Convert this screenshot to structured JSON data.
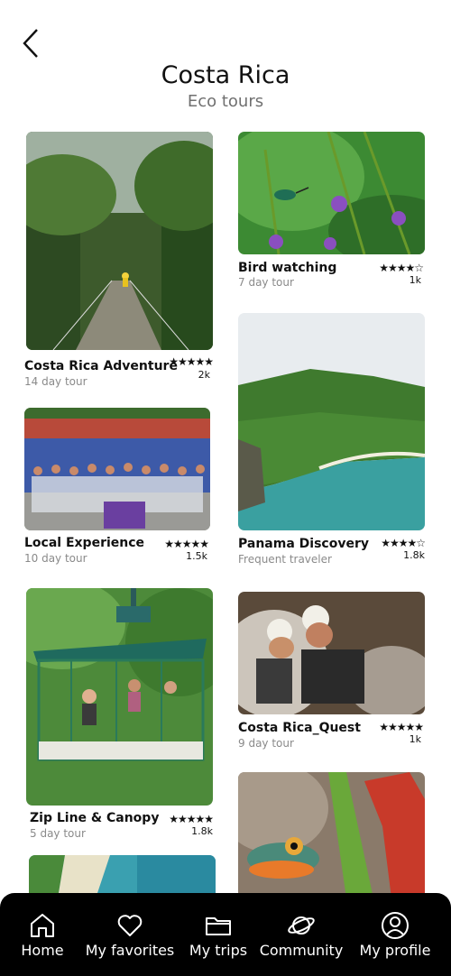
{
  "header": {
    "title": "Costa Rica",
    "subtitle": "Eco tours"
  },
  "tours": [
    {
      "name": "Costa Rica Adventure",
      "subtitle": "14 day tour",
      "stars": "★★★★★",
      "count": "2k"
    },
    {
      "name": "Bird watching",
      "subtitle": "7 day tour",
      "stars": "★★★★☆",
      "count": "1k"
    },
    {
      "name": "Local Experience",
      "subtitle": "10 day tour",
      "stars": "★★★★★",
      "count": "1.5k"
    },
    {
      "name": "Panama Discovery",
      "subtitle": "Frequent traveler",
      "stars": "★★★★☆",
      "count": "1.8k"
    },
    {
      "name": "Zip Line & Canopy",
      "subtitle": "5 day tour",
      "stars": "★★★★★",
      "count": "1.8k"
    },
    {
      "name": "Costa Rica_Quest",
      "subtitle": "9 day tour",
      "stars": "★★★★★",
      "count": "1k"
    }
  ],
  "nav": [
    {
      "label": "Home",
      "icon": "home-icon"
    },
    {
      "label": "My favorites",
      "icon": "heart-icon"
    },
    {
      "label": "My trips",
      "icon": "folder-icon"
    },
    {
      "label": "Community",
      "icon": "planet-icon"
    },
    {
      "label": "My profile",
      "icon": "profile-icon"
    }
  ],
  "colors": {
    "nav_background": "#000000",
    "subtitle_gray": "#707070",
    "meta_gray": "#8a8a8a"
  }
}
